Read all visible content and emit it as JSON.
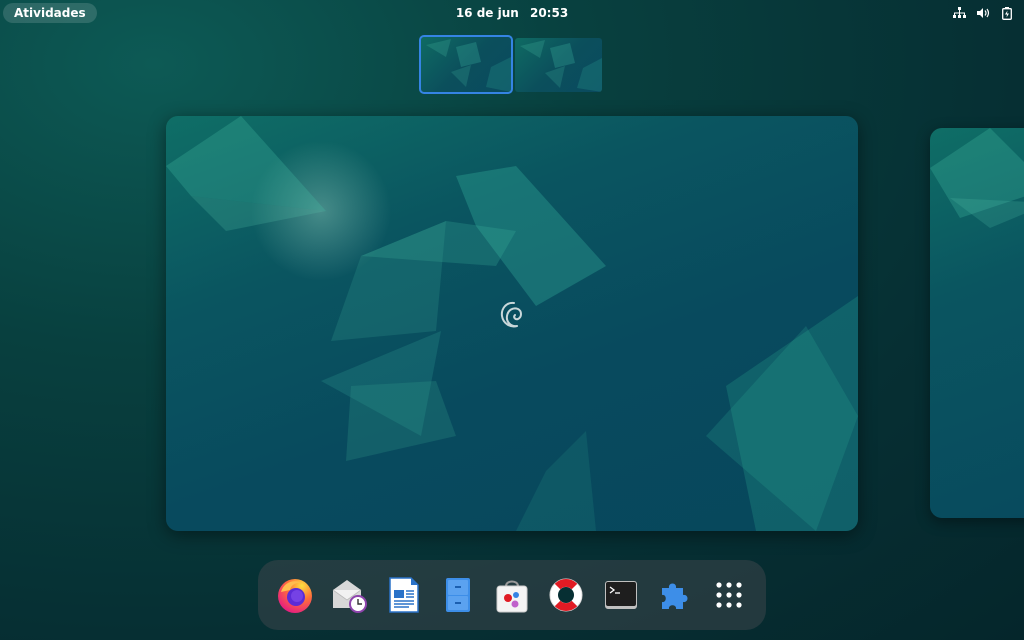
{
  "topbar": {
    "activities_label": "Atividades",
    "date": "16 de jun",
    "time": "20:53",
    "tray": [
      "network-icon",
      "volume-icon",
      "battery-icon"
    ]
  },
  "workspaces": {
    "count": 2,
    "active_index": 0
  },
  "dock": {
    "items": [
      {
        "name": "firefox-icon",
        "app": "firefox"
      },
      {
        "name": "evolution-mail-icon",
        "app": "mail-calendar"
      },
      {
        "name": "libreoffice-writer-icon",
        "app": "writer"
      },
      {
        "name": "file-cabinet-icon",
        "app": "files"
      },
      {
        "name": "software-store-icon",
        "app": "software"
      },
      {
        "name": "help-lifebuoy-icon",
        "app": "help"
      },
      {
        "name": "terminal-icon",
        "app": "terminal"
      },
      {
        "name": "extensions-puzzle-icon",
        "app": "extensions"
      },
      {
        "name": "app-grid-icon",
        "app": "show-apps"
      }
    ]
  },
  "colors": {
    "accent": "#3584e4",
    "background": "#062f33"
  }
}
